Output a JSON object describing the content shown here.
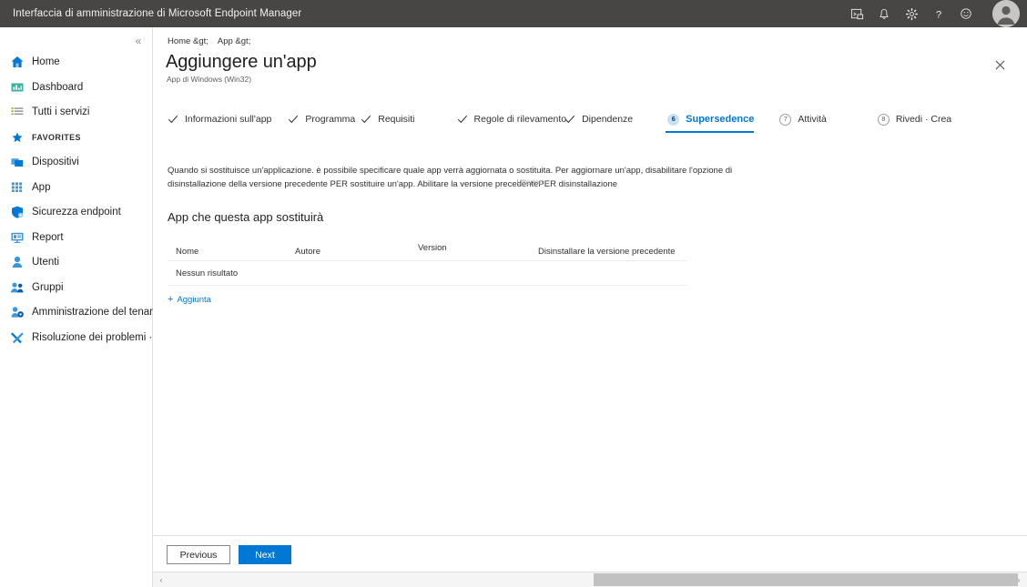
{
  "topbar": {
    "title": "Interfaccia di amministrazione di Microsoft Endpoint Manager",
    "icons": [
      {
        "name": "cloud-shell-icon",
        "glyph": "cloud-shell"
      },
      {
        "name": "notifications-bell-icon",
        "glyph": "bell"
      },
      {
        "name": "settings-gear-icon",
        "glyph": "gear"
      },
      {
        "name": "help-question-icon",
        "glyph": "question"
      },
      {
        "name": "feedback-smiley-icon",
        "glyph": "smiley"
      }
    ],
    "avatar_label": "account-avatar"
  },
  "sidebar": {
    "collapse_glyph": "«",
    "items": [
      {
        "label": "Home",
        "icon": "home-icon"
      },
      {
        "label": "Dashboard",
        "icon": "dashboard-icon"
      },
      {
        "label": "Tutti i servizi",
        "icon": "all-services-icon"
      },
      {
        "label": "FAVORITES",
        "icon": "star-icon"
      },
      {
        "label": "Dispositivi",
        "icon": "devices-icon"
      },
      {
        "label": "App",
        "icon": "apps-icon"
      },
      {
        "label": "Sicurezza endpoint",
        "icon": "shield-icon"
      },
      {
        "label": "Report",
        "icon": "reports-icon"
      },
      {
        "label": "Utenti",
        "icon": "user-icon"
      },
      {
        "label": "Gruppi",
        "icon": "groups-icon"
      },
      {
        "label": "Amministrazione del tenant",
        "icon": "tenant-admin-icon"
      },
      {
        "label": "Risoluzione dei problemi · Supporto",
        "icon": "troubleshoot-icon"
      }
    ]
  },
  "blade": {
    "breadcrumb": [
      "Home &gt;",
      "App &gt;"
    ],
    "title": "Aggiungere un'app",
    "subtitle": "App di Windows (Win32)",
    "close_label": "close-blade"
  },
  "wizard": {
    "tabs": [
      {
        "label": "Informazioni sull'app",
        "state": "done",
        "marker": "✓"
      },
      {
        "label": "Programma",
        "state": "done",
        "marker": "✓"
      },
      {
        "label": "Requisiti",
        "state": "done",
        "marker": "✓"
      },
      {
        "label": "Regole di rilevamento",
        "state": "done",
        "marker": "✓"
      },
      {
        "label": "Dipendenze",
        "state": "done",
        "marker": "✓"
      },
      {
        "label": "Supersedence",
        "state": "active",
        "marker": "6"
      },
      {
        "label": "Attività",
        "state": "todo",
        "marker": "7"
      },
      {
        "label": "Rivedi · Crea",
        "state": "todo",
        "marker": "8"
      }
    ]
  },
  "description": {
    "line1": "Quando si sostituisce un'applicazione. è possibile specificare quale app verrà aggiornata o sostituita. Per aggiornare un'app, disabilitare l'opzione di",
    "line2_before": "disinstallazione della versione precedente PER sostituire un'app. Abilitare la versione precedente",
    "line2_overlap_under": "PER disinstallazione",
    "line2_overlap_over": "Ulteriori"
  },
  "section": {
    "title": "App che questa app sostituirà"
  },
  "table": {
    "columns": [
      "Nome",
      "Autore",
      "Version",
      "Disinstallare la versione precedente"
    ],
    "rows": [],
    "empty_text": "Nessun risultato"
  },
  "add_link": {
    "plus": "+",
    "label": "Aggiunta"
  },
  "footer": {
    "previous_label": "Previous",
    "next_label": "Next"
  },
  "scrollbar": {
    "left_arrow": "‹",
    "right_arrow": "›"
  },
  "colors": {
    "topbar_bg": "#484644",
    "accent": "#0078d4",
    "active_tab_circle": "#c7e0f4",
    "border": "#e1dfdd",
    "text": "#323130"
  }
}
